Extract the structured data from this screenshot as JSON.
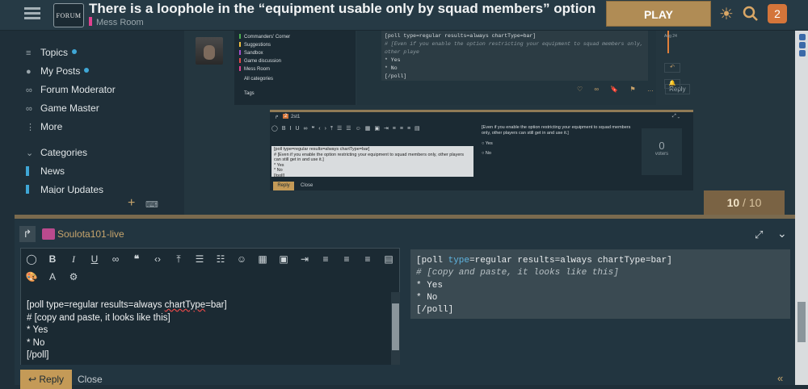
{
  "header": {
    "logo_text": "FORUM",
    "title": "There is a loophole in the “equipment usable only by squad members” option",
    "category": "Mess Room",
    "category_color": "#e0418f",
    "play_label": "PLAY",
    "notification_count": "2"
  },
  "sidebar": {
    "items": [
      {
        "label": "Topics",
        "icon": "layers-icon"
      },
      {
        "label": "My Posts",
        "icon": "user-icon"
      },
      {
        "label": "Forum Moderator",
        "icon": "link-icon"
      },
      {
        "label": "Game Master",
        "icon": "link-icon"
      },
      {
        "label": "More",
        "icon": "ellipsis-icon"
      }
    ],
    "categories_label": "Categories",
    "categories": [
      {
        "label": "News",
        "color": "#3fa7d6"
      },
      {
        "label": "Major Updates",
        "color": "#3fa7d6"
      }
    ]
  },
  "background_post": {
    "mini_sidebar": [
      "Commanders' Corner",
      "Suggestions",
      "Sandbox",
      "Game discussion",
      "Mess Room",
      "All categories",
      "Tags"
    ],
    "code_lines": [
      "[poll type=regular results=always chartType=bar]",
      "# [Even if you enable the option restricting your equipment to squad members only, other playe",
      "* Yes",
      "* No",
      "[/poll]"
    ],
    "date": "Aug 24",
    "reply_label": "Reply",
    "nested_composer": {
      "username": "2st1",
      "editor_lines": [
        "[poll type=regular results=always chartType=bar]",
        "# [Even if you enable the option restricting your equipment to squad members only, other players can still get in and use it.]",
        "* Yes",
        "* No",
        "[/poll]"
      ],
      "preview_text": "[Even if you enable the option restricting your equipment to squad members only, other players can still get in and use it.]",
      "options": [
        "Yes",
        "No"
      ],
      "voters_count": "0",
      "voters_label": "voters",
      "reply_label": "Reply",
      "close_label": "Close"
    }
  },
  "page_counter": {
    "current": "10",
    "total": "/ 10"
  },
  "composer": {
    "username": "Soulota101-live",
    "editor_lines": [
      "[poll type=regular results=always ",
      "chartType",
      "=bar]",
      "# [copy and paste, it looks like this]",
      "* Yes",
      "* No",
      "[/poll]"
    ],
    "preview": {
      "line1_prefix": "[poll ",
      "line1_kw": "type",
      "line1_rest": "=regular results=always chartType=bar]",
      "line2": "# [copy and paste, it looks like this]",
      "line3": "* Yes",
      "line4": "* No",
      "line5": "[/poll]"
    },
    "reply_label": "Reply",
    "close_label": "Close"
  },
  "colors": {
    "accent": "#c49a57",
    "header_bg": "#263a45",
    "badge": "#d4753a"
  }
}
